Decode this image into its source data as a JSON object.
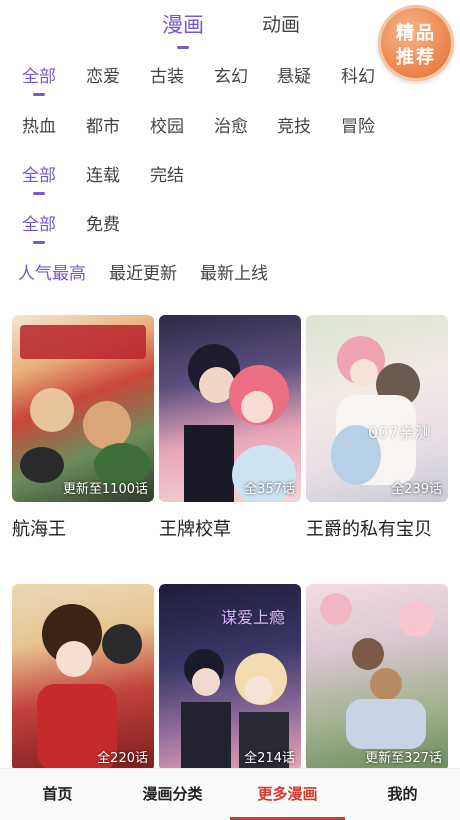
{
  "top_tabs": [
    {
      "label": "漫画",
      "active": true
    },
    {
      "label": "动画",
      "active": false
    }
  ],
  "promo": {
    "line1": "精品",
    "line2": "推荐"
  },
  "filters": {
    "genre_row1": [
      "全部",
      "恋爱",
      "古装",
      "玄幻",
      "悬疑",
      "科幻"
    ],
    "genre_row2": [
      "热血",
      "都市",
      "校园",
      "治愈",
      "竞技",
      "冒险"
    ],
    "status": [
      "全部",
      "连载",
      "完结"
    ],
    "price": [
      "全部",
      "免费"
    ],
    "sort": [
      "人气最高",
      "最近更新",
      "最新上线"
    ]
  },
  "active_filters": {
    "genre": "全部",
    "status": "全部",
    "price": "全部",
    "sort": "人气最高"
  },
  "comics": [
    {
      "title": "航海王",
      "badge": "更新至1100话",
      "cover_text": ""
    },
    {
      "title": "王牌校草",
      "badge": "全357话",
      "cover_text": ""
    },
    {
      "title": "王爵的私有宝贝",
      "badge": "全239话",
      "cover_text": "007亲测"
    },
    {
      "title": "",
      "badge": "全220话",
      "cover_text": ""
    },
    {
      "title": "",
      "badge": "全214话",
      "cover_text": "谋爱上瘾"
    },
    {
      "title": "",
      "badge": "更新至327话",
      "cover_text": ""
    }
  ],
  "bottom_nav": [
    {
      "label": "首页",
      "active": false
    },
    {
      "label": "漫画分类",
      "active": false
    },
    {
      "label": "更多漫画",
      "active": true
    },
    {
      "label": "我的",
      "active": false
    }
  ],
  "colors": {
    "accent": "#7b58c9",
    "nav_active": "#d23a2b"
  }
}
